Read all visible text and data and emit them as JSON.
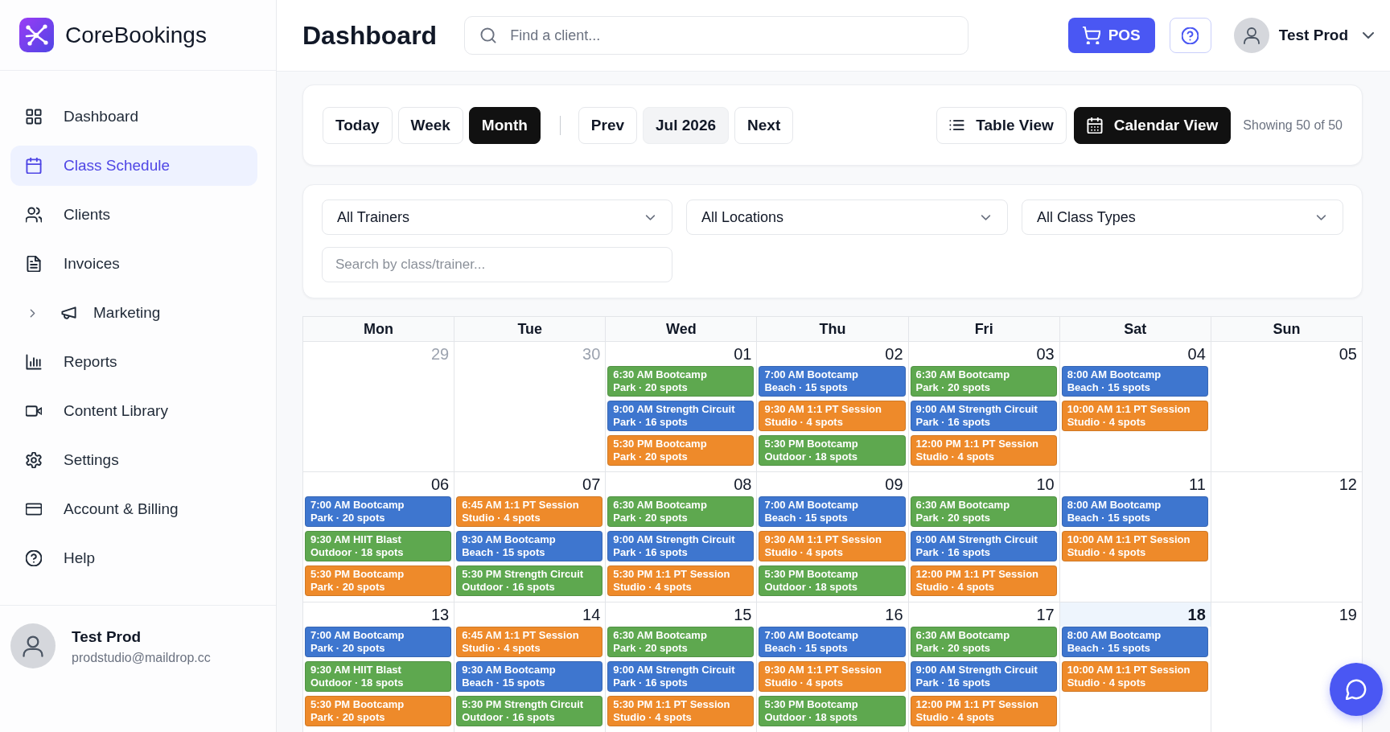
{
  "app": {
    "name": "CoreBookings"
  },
  "sidebar": {
    "items": [
      {
        "label": "Dashboard",
        "kind": "link",
        "selected": false
      },
      {
        "label": "Class Schedule",
        "kind": "link",
        "selected": true
      },
      {
        "label": "Clients",
        "kind": "link",
        "selected": false
      },
      {
        "label": "Invoices",
        "kind": "link",
        "selected": false
      },
      {
        "label": "Marketing",
        "kind": "group",
        "selected": false,
        "expanded": false
      },
      {
        "label": "Reports",
        "kind": "link",
        "selected": false
      },
      {
        "label": "Content Library",
        "kind": "link",
        "selected": false
      },
      {
        "label": "Settings",
        "kind": "link",
        "selected": false
      },
      {
        "label": "Account & Billing",
        "kind": "link",
        "selected": false
      },
      {
        "label": "Help",
        "kind": "link",
        "selected": false
      }
    ],
    "user": {
      "name": "Test Prod",
      "email": "prodstudio@maildrop.cc"
    }
  },
  "header": {
    "title": "Dashboard",
    "search": {
      "placeholder": "Find a client..."
    },
    "pos_button": {
      "label": "POS"
    },
    "user": {
      "name": "Test Prod"
    }
  },
  "toolbar": {
    "range_buttons": [
      {
        "label": "Today",
        "selected": false
      },
      {
        "label": "Week",
        "selected": false
      },
      {
        "label": "Month",
        "selected": true
      }
    ],
    "navigation": {
      "prev": "Prev",
      "period": "Jul 2026",
      "next": "Next"
    },
    "view_buttons": [
      {
        "label": "Table View",
        "selected": false
      },
      {
        "label": "Calendar View",
        "selected": true
      }
    ],
    "count": "Showing 50 of 50"
  },
  "filters": {
    "selects": [
      {
        "value": "All Trainers"
      },
      {
        "value": "All Locations"
      },
      {
        "value": "All Class Types"
      }
    ],
    "search": {
      "placeholder": "Search by class/trainer..."
    }
  },
  "calendar": {
    "weekdays": [
      "Mon",
      "Tue",
      "Wed",
      "Thu",
      "Fri",
      "Sat",
      "Sun"
    ],
    "weeks": [
      {
        "days": [
          {
            "date": "29",
            "in_month": false,
            "today": false
          },
          {
            "date": "30",
            "in_month": false,
            "today": false
          },
          {
            "date": "01",
            "in_month": true,
            "today": false,
            "events": [
              {
                "title": "6:30 AM Bootcamp",
                "detail": "Park · 20 spots",
                "color": "#5ea84f"
              },
              {
                "title": "9:00 AM Strength Circuit",
                "detail": "Park · 16 spots",
                "color": "#3e76cf"
              },
              {
                "title": "5:30 PM Bootcamp",
                "detail": "Park · 20 spots",
                "color": "#ee8a2a"
              }
            ]
          },
          {
            "date": "02",
            "in_month": true,
            "today": false,
            "events": [
              {
                "title": "7:00 AM Bootcamp",
                "detail": "Beach · 15 spots",
                "color": "#3e76cf"
              },
              {
                "title": "9:30 AM 1:1 PT Session",
                "detail": "Studio · 4 spots",
                "color": "#ee8a2a"
              },
              {
                "title": "5:30 PM Bootcamp",
                "detail": "Outdoor · 18 spots",
                "color": "#5ea84f"
              }
            ]
          },
          {
            "date": "03",
            "in_month": true,
            "today": false,
            "events": [
              {
                "title": "6:30 AM Bootcamp",
                "detail": "Park · 20 spots",
                "color": "#5ea84f"
              },
              {
                "title": "9:00 AM Strength Circuit",
                "detail": "Park · 16 spots",
                "color": "#3e76cf"
              },
              {
                "title": "12:00 PM 1:1 PT Session",
                "detail": "Studio · 4 spots",
                "color": "#ee8a2a"
              }
            ]
          },
          {
            "date": "04",
            "in_month": true,
            "today": false,
            "events": [
              {
                "title": "8:00 AM Bootcamp",
                "detail": "Beach · 15 spots",
                "color": "#3e76cf"
              },
              {
                "title": "10:00 AM 1:1 PT Session",
                "detail": "Studio · 4 spots",
                "color": "#ee8a2a"
              }
            ]
          },
          {
            "date": "05",
            "in_month": true,
            "today": false
          }
        ]
      },
      {
        "days": [
          {
            "date": "06",
            "in_month": true,
            "today": false,
            "events": [
              {
                "title": "7:00 AM Bootcamp",
                "detail": "Park · 20 spots",
                "color": "#3e76cf"
              },
              {
                "title": "9:30 AM HIIT Blast",
                "detail": "Outdoor · 18 spots",
                "color": "#5ea84f"
              },
              {
                "title": "5:30 PM Bootcamp",
                "detail": "Park · 20 spots",
                "color": "#ee8a2a"
              }
            ]
          },
          {
            "date": "07",
            "in_month": true,
            "today": false,
            "events": [
              {
                "title": "6:45 AM 1:1 PT Session",
                "detail": "Studio · 4 spots",
                "color": "#ee8a2a"
              },
              {
                "title": "9:30 AM Bootcamp",
                "detail": "Beach · 15 spots",
                "color": "#3e76cf"
              },
              {
                "title": "5:30 PM Strength Circuit",
                "detail": "Outdoor · 16 spots",
                "color": "#5ea84f"
              }
            ]
          },
          {
            "date": "08",
            "in_month": true,
            "today": false,
            "events": [
              {
                "title": "6:30 AM Bootcamp",
                "detail": "Park · 20 spots",
                "color": "#5ea84f"
              },
              {
                "title": "9:00 AM Strength Circuit",
                "detail": "Park · 16 spots",
                "color": "#3e76cf"
              },
              {
                "title": "5:30 PM 1:1 PT Session",
                "detail": "Studio · 4 spots",
                "color": "#ee8a2a"
              }
            ]
          },
          {
            "date": "09",
            "in_month": true,
            "today": false,
            "events": [
              {
                "title": "7:00 AM Bootcamp",
                "detail": "Beach · 15 spots",
                "color": "#3e76cf"
              },
              {
                "title": "9:30 AM 1:1 PT Session",
                "detail": "Studio · 4 spots",
                "color": "#ee8a2a"
              },
              {
                "title": "5:30 PM Bootcamp",
                "detail": "Outdoor · 18 spots",
                "color": "#5ea84f"
              }
            ]
          },
          {
            "date": "10",
            "in_month": true,
            "today": false,
            "events": [
              {
                "title": "6:30 AM Bootcamp",
                "detail": "Park · 20 spots",
                "color": "#5ea84f"
              },
              {
                "title": "9:00 AM Strength Circuit",
                "detail": "Park · 16 spots",
                "color": "#3e76cf"
              },
              {
                "title": "12:00 PM 1:1 PT Session",
                "detail": "Studio · 4 spots",
                "color": "#ee8a2a"
              }
            ]
          },
          {
            "date": "11",
            "in_month": true,
            "today": false,
            "events": [
              {
                "title": "8:00 AM Bootcamp",
                "detail": "Beach · 15 spots",
                "color": "#3e76cf"
              },
              {
                "title": "10:00 AM 1:1 PT Session",
                "detail": "Studio · 4 spots",
                "color": "#ee8a2a"
              }
            ]
          },
          {
            "date": "12",
            "in_month": true,
            "today": false
          }
        ]
      },
      {
        "days": [
          {
            "date": "13",
            "in_month": true,
            "today": false,
            "events": [
              {
                "title": "7:00 AM Bootcamp",
                "detail": "Park · 20 spots",
                "color": "#3e76cf"
              },
              {
                "title": "9:30 AM HIIT Blast",
                "detail": "Outdoor · 18 spots",
                "color": "#5ea84f"
              },
              {
                "title": "5:30 PM Bootcamp",
                "detail": "Park · 20 spots",
                "color": "#ee8a2a"
              }
            ]
          },
          {
            "date": "14",
            "in_month": true,
            "today": false,
            "events": [
              {
                "title": "6:45 AM 1:1 PT Session",
                "detail": "Studio · 4 spots",
                "color": "#ee8a2a"
              },
              {
                "title": "9:30 AM Bootcamp",
                "detail": "Beach · 15 spots",
                "color": "#3e76cf"
              },
              {
                "title": "5:30 PM Strength Circuit",
                "detail": "Outdoor · 16 spots",
                "color": "#5ea84f"
              }
            ]
          },
          {
            "date": "15",
            "in_month": true,
            "today": false,
            "events": [
              {
                "title": "6:30 AM Bootcamp",
                "detail": "Park · 20 spots",
                "color": "#5ea84f"
              },
              {
                "title": "9:00 AM Strength Circuit",
                "detail": "Park · 16 spots",
                "color": "#3e76cf"
              },
              {
                "title": "5:30 PM 1:1 PT Session",
                "detail": "Studio · 4 spots",
                "color": "#ee8a2a"
              }
            ]
          },
          {
            "date": "16",
            "in_month": true,
            "today": false,
            "events": [
              {
                "title": "7:00 AM Bootcamp",
                "detail": "Beach · 15 spots",
                "color": "#3e76cf"
              },
              {
                "title": "9:30 AM 1:1 PT Session",
                "detail": "Studio · 4 spots",
                "color": "#ee8a2a"
              },
              {
                "title": "5:30 PM Bootcamp",
                "detail": "Outdoor · 18 spots",
                "color": "#5ea84f"
              }
            ]
          },
          {
            "date": "17",
            "in_month": true,
            "today": false,
            "events": [
              {
                "title": "6:30 AM Bootcamp",
                "detail": "Park · 20 spots",
                "color": "#5ea84f"
              },
              {
                "title": "9:00 AM Strength Circuit",
                "detail": "Park · 16 spots",
                "color": "#3e76cf"
              },
              {
                "title": "12:00 PM 1:1 PT Session",
                "detail": "Studio · 4 spots",
                "color": "#ee8a2a"
              }
            ]
          },
          {
            "date": "18",
            "in_month": true,
            "today": true,
            "events": [
              {
                "title": "8:00 AM Bootcamp",
                "detail": "Beach · 15 spots",
                "color": "#3e76cf"
              },
              {
                "title": "10:00 AM 1:1 PT Session",
                "detail": "Studio · 4 spots",
                "color": "#ee8a2a"
              }
            ]
          },
          {
            "date": "19",
            "in_month": true,
            "today": false
          }
        ]
      }
    ]
  }
}
